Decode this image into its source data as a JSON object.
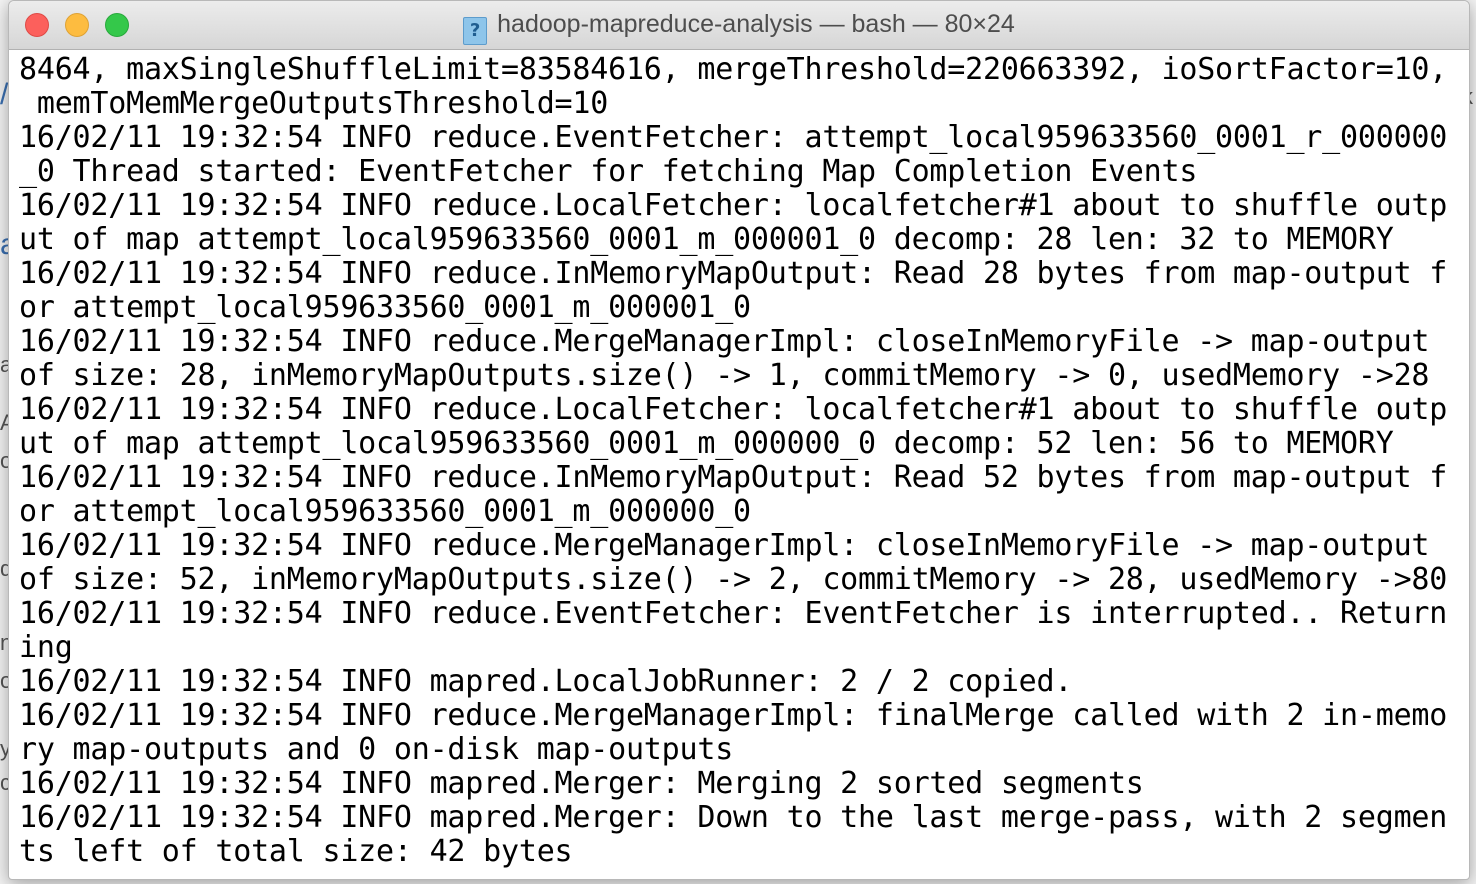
{
  "window": {
    "title": "hadoop-mapreduce-analysis — bash — 80×24",
    "icon": "document-unknown-icon",
    "icon_glyph": "?"
  },
  "background_glyphs": [
    "/",
    "k",
    "a",
    "a",
    "A",
    "o",
    "d",
    "n",
    "o",
    "y",
    "c"
  ],
  "terminal": {
    "lines": [
      "8464, maxSingleShuffleLimit=83584616, mergeThreshold=220663392, ioSortFactor=10,",
      " memToMemMergeOutputsThreshold=10",
      "16/02/11 19:32:54 INFO reduce.EventFetcher: attempt_local959633560_0001_r_000000",
      "_0 Thread started: EventFetcher for fetching Map Completion Events",
      "16/02/11 19:32:54 INFO reduce.LocalFetcher: localfetcher#1 about to shuffle outp",
      "ut of map attempt_local959633560_0001_m_000001_0 decomp: 28 len: 32 to MEMORY",
      "16/02/11 19:32:54 INFO reduce.InMemoryMapOutput: Read 28 bytes from map-output f",
      "or attempt_local959633560_0001_m_000001_0",
      "16/02/11 19:32:54 INFO reduce.MergeManagerImpl: closeInMemoryFile -> map-output",
      "of size: 28, inMemoryMapOutputs.size() -> 1, commitMemory -> 0, usedMemory ->28",
      "16/02/11 19:32:54 INFO reduce.LocalFetcher: localfetcher#1 about to shuffle outp",
      "ut of map attempt_local959633560_0001_m_000000_0 decomp: 52 len: 56 to MEMORY",
      "16/02/11 19:32:54 INFO reduce.InMemoryMapOutput: Read 52 bytes from map-output f",
      "or attempt_local959633560_0001_m_000000_0",
      "16/02/11 19:32:54 INFO reduce.MergeManagerImpl: closeInMemoryFile -> map-output",
      "of size: 52, inMemoryMapOutputs.size() -> 2, commitMemory -> 28, usedMemory ->80",
      "16/02/11 19:32:54 INFO reduce.EventFetcher: EventFetcher is interrupted.. Return",
      "ing",
      "16/02/11 19:32:54 INFO mapred.LocalJobRunner: 2 / 2 copied.",
      "16/02/11 19:32:54 INFO reduce.MergeManagerImpl: finalMerge called with 2 in-memo",
      "ry map-outputs and 0 on-disk map-outputs",
      "16/02/11 19:32:54 INFO mapred.Merger: Merging 2 sorted segments",
      "16/02/11 19:32:54 INFO mapred.Merger: Down to the last merge-pass, with 2 segmen",
      "ts left of total size: 42 bytes"
    ]
  }
}
